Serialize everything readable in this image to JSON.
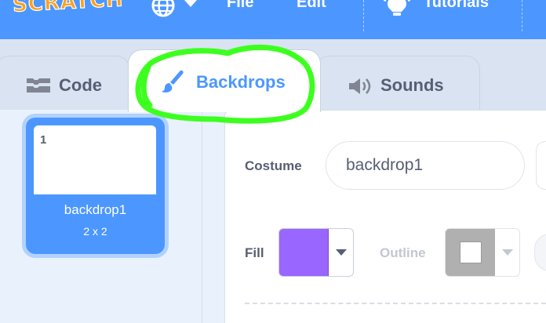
{
  "menubar": {
    "logo": "SCRATCH",
    "file_label": "File",
    "edit_label": "Edit",
    "tutorials_label": "Tutorials",
    "color": "#4c97ff"
  },
  "tabs": [
    {
      "label": "Code",
      "icon": "code-blocks-icon",
      "selected": false
    },
    {
      "label": "Backdrops",
      "icon": "paintbrush-icon",
      "selected": true
    },
    {
      "label": "Sounds",
      "icon": "speaker-icon",
      "selected": false
    }
  ],
  "backdrops": [
    {
      "index": "1",
      "name": "backdrop1",
      "size": "2 x 2",
      "selected": true
    }
  ],
  "editor": {
    "costume_label": "Costume",
    "costume_value": "backdrop1",
    "fill_label": "Fill",
    "fill_color": "#9966ff",
    "outline_label": "Outline",
    "outline_color": "#b0b0b0"
  },
  "annotation": {
    "color": "#3dff1f",
    "target": "Backdrops"
  }
}
